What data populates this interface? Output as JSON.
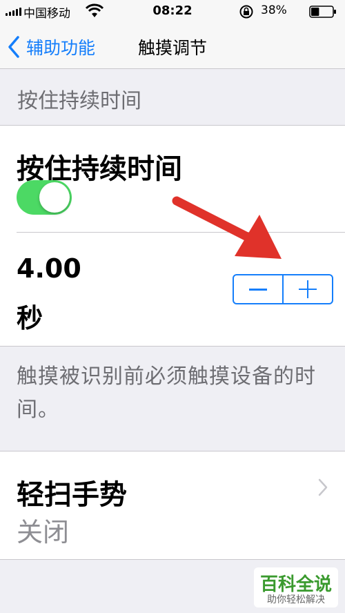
{
  "status_bar": {
    "carrier": "中国移动",
    "time": "08:22",
    "battery_percent": "38%",
    "battery_level": 0.38,
    "icons": [
      "signal-icon",
      "wifi-icon",
      "rotation-lock-icon",
      "battery-icon"
    ]
  },
  "nav": {
    "back_label": "辅助功能",
    "title": "触摸调节"
  },
  "section": {
    "header": "按住持续时间"
  },
  "hold_duration": {
    "title": "按住持续时间",
    "toggle_on": true,
    "value": "4.00",
    "unit": "秒",
    "stepper": {
      "minus_icon": "minus-icon",
      "plus_icon": "plus-icon"
    }
  },
  "footer_note": "触摸被识别前必须触摸设备的时间。",
  "swipe_gestures": {
    "title": "轻扫手势",
    "value": "关闭"
  },
  "overlay": {
    "arrow_color": "#e0322a"
  },
  "watermark": {
    "main": "百科全说",
    "sub": "助你轻松解决"
  },
  "colors": {
    "accent": "#147efb",
    "toggle_on": "#4cd964",
    "background": "#efeff4"
  }
}
